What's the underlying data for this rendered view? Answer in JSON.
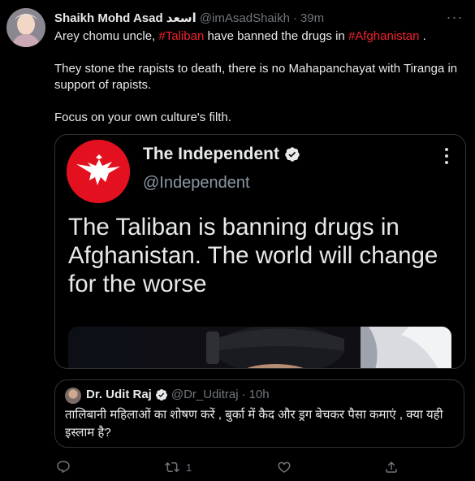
{
  "tweet": {
    "display_name": "Shaikh Mohd Asad اسعد",
    "handle": "@imAsadShaikh",
    "dot": "·",
    "time": "39m",
    "more_label": "···",
    "line1_prefix": "Arey chomu uncle, ",
    "hashtag1": "#Taliban",
    "line1_middle": " have banned the drugs in ",
    "hashtag2": "#Afghanistan",
    "line1_suffix": " .",
    "paragraph2": "They stone the rapists to death, there is no Mahapanchayat with Tiranga in support of rapists.",
    "paragraph3": "Focus on your own culture's filth."
  },
  "media": {
    "source_name": "The Independent",
    "source_handle": "@Independent",
    "headline": "The Taliban is banning drugs in Afghanistan. The world will change for the worse"
  },
  "quote": {
    "display_name": "Dr. Udit Raj",
    "handle": "@Dr_Uditraj",
    "dot": "·",
    "time": "10h",
    "text": "तालिबानी महिलाओं का  शोषण करें , बुर्का में कैद और ड्रग बेचकर पैसा कमाएं , क्या यही इस्लाम है?"
  },
  "actions": {
    "reply_icon": "reply-icon",
    "retweet_icon": "retweet-icon",
    "retweet_count": "1",
    "like_icon": "like-icon",
    "share_icon": "share-icon"
  },
  "colors": {
    "background": "#000000",
    "text": "#e7e9ea",
    "muted": "#71767b",
    "hashtag": "#f4212e",
    "border": "#2f3336",
    "independent_red": "#e3111f"
  }
}
